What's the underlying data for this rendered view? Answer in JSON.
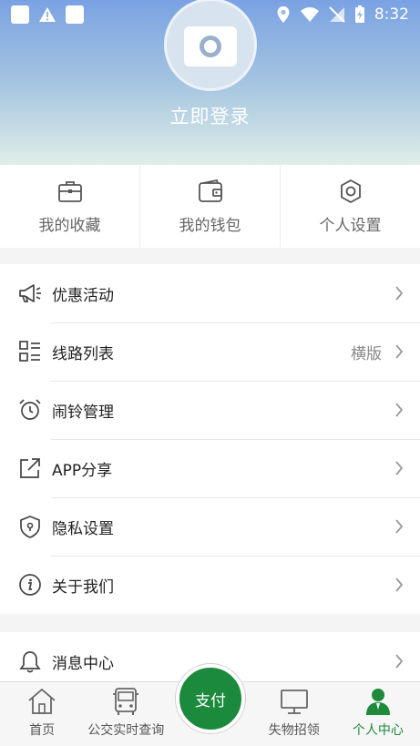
{
  "status_bar": {
    "time": "8:32"
  },
  "header": {
    "login_text": "立即登录"
  },
  "quick_actions": [
    {
      "label": "我的收藏",
      "icon": "briefcase-icon"
    },
    {
      "label": "我的钱包",
      "icon": "wallet-icon"
    },
    {
      "label": "个人设置",
      "icon": "settings-icon"
    }
  ],
  "menu": [
    {
      "label": "优惠活动",
      "icon": "megaphone-icon",
      "value": ""
    },
    {
      "label": "线路列表",
      "icon": "list-icon",
      "value": "横版"
    },
    {
      "label": "闹铃管理",
      "icon": "alarm-clock-icon",
      "value": ""
    },
    {
      "label": "APP分享",
      "icon": "share-icon",
      "value": ""
    },
    {
      "label": "隐私设置",
      "icon": "shield-icon",
      "value": ""
    },
    {
      "label": "关于我们",
      "icon": "info-icon",
      "value": ""
    },
    {
      "label": "消息中心",
      "icon": "bell-icon",
      "value": ""
    }
  ],
  "bottom_nav": {
    "items": [
      {
        "label": "首页",
        "icon": "home-icon"
      },
      {
        "label": "公交实时查询",
        "icon": "bus-icon"
      },
      {
        "label": "失物招领",
        "icon": "monitor-icon"
      },
      {
        "label": "个人中心",
        "icon": "person-icon"
      }
    ],
    "pay_label": "支付",
    "active_color": "#1e8a3a"
  }
}
